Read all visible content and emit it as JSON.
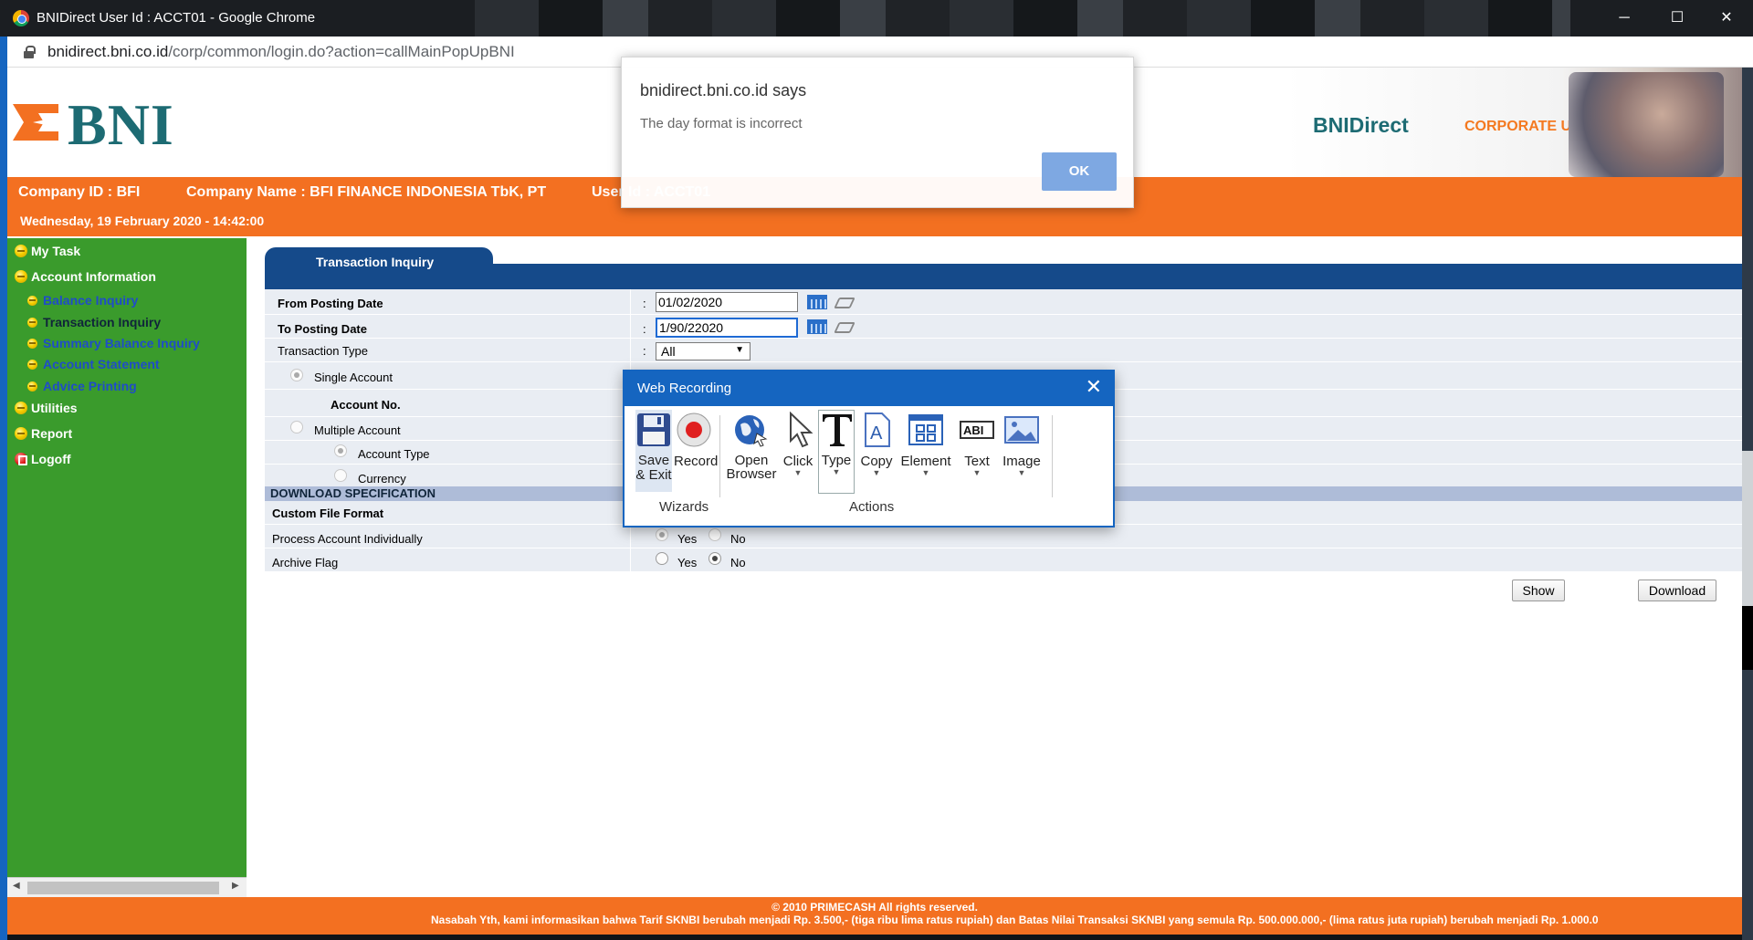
{
  "window": {
    "title": "BNIDirect User Id : ACCT01 - Google Chrome",
    "min": "─",
    "max": "☐",
    "close": "✕"
  },
  "address": {
    "domain": "bnidirect.bni.co.id",
    "path": "/corp/common/login.do?action=callMainPopUpBNI"
  },
  "header": {
    "logo_text": "BNI",
    "banner_title": "BNIDirect",
    "banner_sub": "CORPORATE USER"
  },
  "info": {
    "company_id": "Company ID : BFI",
    "company_name": "Company Name : BFI FINANCE INDONESIA TbK, PT",
    "user_id": "User Id : ACCT01",
    "datetime": "Wednesday, 19 February 2020 - 14:42:00"
  },
  "nav": {
    "my_task": "My Task",
    "account_information": "Account Information",
    "subitems": [
      "Balance Inquiry",
      "Transaction Inquiry",
      "Summary Balance Inquiry",
      "Account Statement",
      "Advice Printing"
    ],
    "utilities": "Utilities",
    "report": "Report",
    "logoff": "Logoff"
  },
  "form": {
    "tab_title": "Transaction Inquiry",
    "from_posting_date_label": "From Posting Date",
    "from_posting_date_value": "01/02/2020",
    "to_posting_date_label": "To Posting Date",
    "to_posting_date_value": "1/90/22020",
    "transaction_type_label": "Transaction Type",
    "transaction_type_value": "All",
    "single_account": "Single Account",
    "account_no": "Account No.",
    "multiple_account": "Multiple Account",
    "account_type": "Account Type",
    "currency": "Currency",
    "download_spec": "DOWNLOAD SPECIFICATION",
    "custom_file_format": "Custom File Format",
    "process_account_individually": "Process Account Individually",
    "archive_flag": "Archive Flag",
    "yes": "Yes",
    "no": "No",
    "colon": ":",
    "show_button": "Show",
    "download_button": "Download"
  },
  "footer": {
    "copyright": "© 2010 PRIMECASH All rights reserved.",
    "notice": "Nasabah Yth, kami informasikan bahwa Tarif SKNBI berubah menjadi Rp. 3.500,- (tiga ribu lima ratus rupiah) dan Batas Nilai Transaksi SKNBI yang semula Rp. 500.000.000,- (lima ratus juta rupiah) berubah menjadi Rp. 1.000.0"
  },
  "alert": {
    "title": "bnidirect.bni.co.id says",
    "message": "The day format is incorrect",
    "ok": "OK"
  },
  "recorder": {
    "title": "Web Recording",
    "tools": {
      "save": "Save & Exit",
      "record": "Record",
      "open_browser": "Open Browser",
      "click": "Click",
      "type": "Type",
      "copy": "Copy",
      "element": "Element",
      "text": "Text",
      "image": "Image"
    },
    "groups": {
      "wizards": "Wizards",
      "actions": "Actions"
    }
  },
  "colors": {
    "orange": "#f37021",
    "nav_green": "#3a9b2c",
    "bni_teal": "#1d6b73",
    "tab_blue": "#154a8a",
    "recorder_blue": "#1565c0"
  }
}
